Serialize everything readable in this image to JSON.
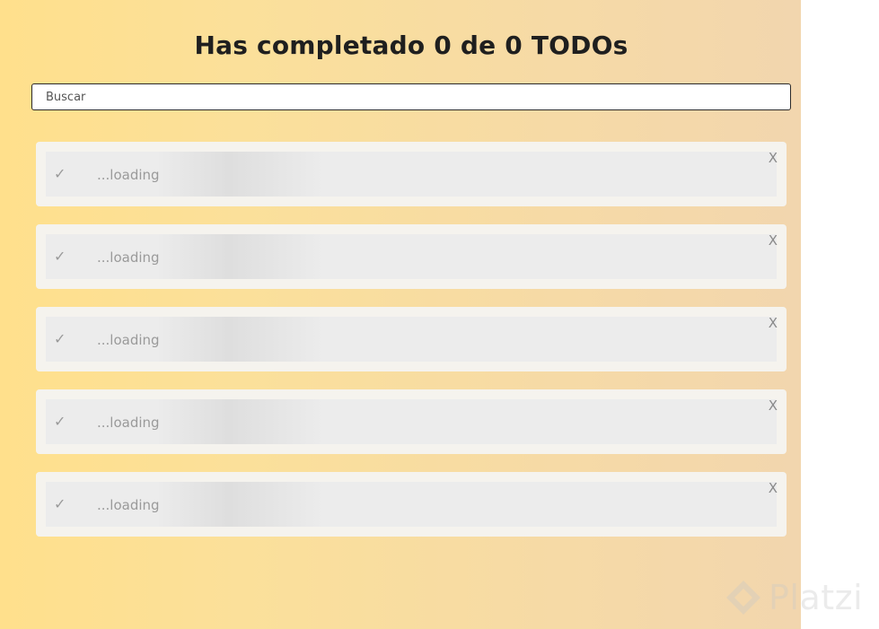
{
  "header": {
    "title": "Has completado 0 de 0 TODOs"
  },
  "search": {
    "placeholder": "Buscar",
    "value": ""
  },
  "todos": [
    {
      "check": "✓",
      "text": "...loading",
      "delete": "X"
    },
    {
      "check": "✓",
      "text": "...loading",
      "delete": "X"
    },
    {
      "check": "✓",
      "text": "...loading",
      "delete": "X"
    },
    {
      "check": "✓",
      "text": "...loading",
      "delete": "X"
    },
    {
      "check": "✓",
      "text": "...loading",
      "delete": "X"
    }
  ],
  "watermark": {
    "text": "Platzi",
    "icon": "platzi-logo-icon"
  },
  "colors": {
    "background_start": "#ffe08c",
    "background_end": "#f2d6ae",
    "card": "#f5f3ee",
    "skeleton": "#ececec",
    "title": "#1f1f1f"
  }
}
